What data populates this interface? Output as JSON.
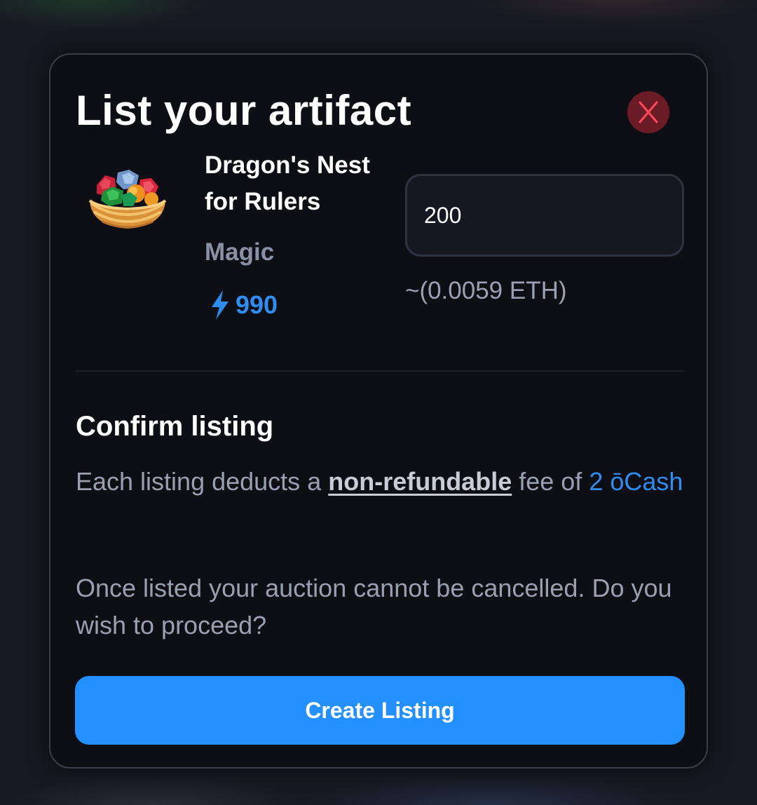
{
  "modal": {
    "title": "List your artifact",
    "close_icon": "close-x-icon",
    "accent_color": "#2490fe",
    "close_color": "#6b1b26"
  },
  "artifact": {
    "name": "Dragon's Nest for Rulers",
    "category": "Magic",
    "power_icon": "lightning-bolt-icon",
    "power": "990",
    "image_icon": "nest-of-gems-icon"
  },
  "price": {
    "value": "200",
    "eth_equivalent": "~(0.0059 ETH)"
  },
  "confirm": {
    "heading": "Confirm listing",
    "fee_prefix": "Each listing deducts a",
    "fee_emphasis": "non-refundable",
    "fee_middle": "fee of",
    "fee_amount": "2 ōCash",
    "warning": "Once listed your auction cannot be cancelled. Do you wish to proceed?"
  },
  "actions": {
    "create_label": "Create Listing"
  }
}
